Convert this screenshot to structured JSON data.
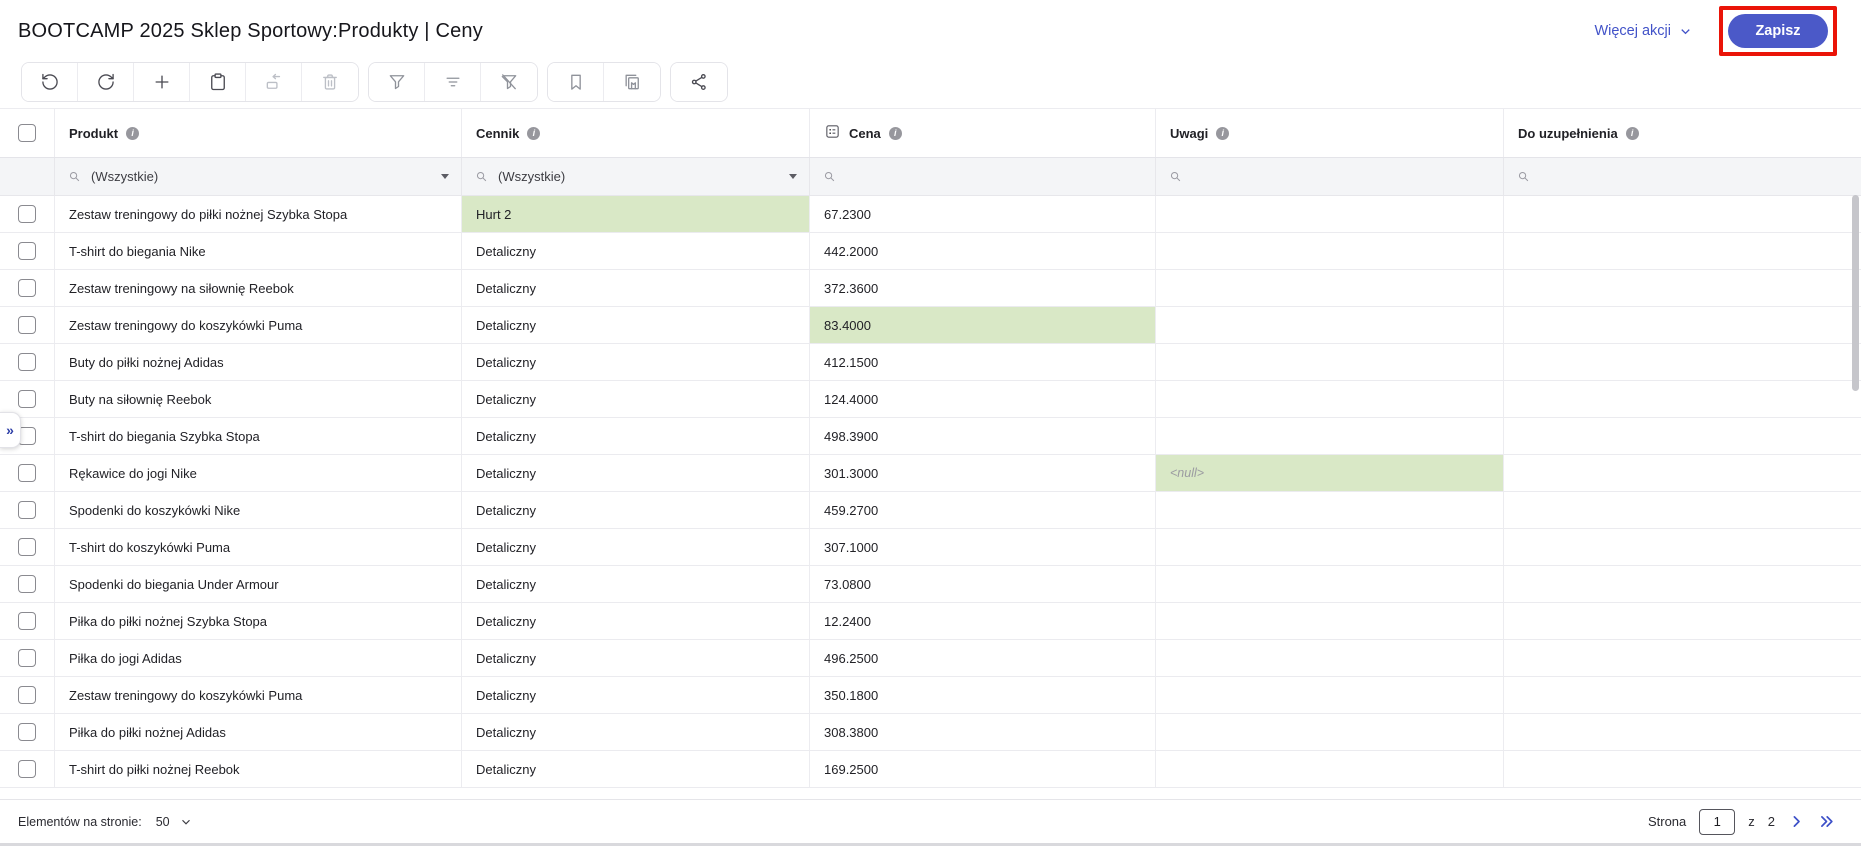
{
  "page": {
    "title": "BOOTCAMP 2025 Sklep Sportowy:Produkty | Ceny"
  },
  "header": {
    "more_actions": "Więcej akcji",
    "save": "Zapisz"
  },
  "colors": {
    "accent": "#4b59c8",
    "link": "#4152c8",
    "highlight_green": "#d9e8c6",
    "annotation_red": "#ea1408"
  },
  "toolbar": {
    "groups": [
      [
        "undo-icon",
        "redo-icon",
        "add-record-icon",
        "paste-icon",
        "insert-row-icon",
        "delete-icon"
      ],
      [
        "filter-icon",
        "filter-list-icon",
        "clear-filter-icon"
      ],
      [
        "bookmark-icon",
        "bookmarks-copy-icon"
      ],
      [
        "share-icon"
      ]
    ]
  },
  "table": {
    "columns": [
      {
        "label": "Produkt"
      },
      {
        "label": "Cennik"
      },
      {
        "label": "Cena"
      },
      {
        "label": "Uwagi"
      },
      {
        "label": "Do uzupełnienia"
      }
    ],
    "filter_all": "(Wszystkie)",
    "rows": [
      {
        "produkt": "Zestaw treningowy do piłki nożnej Szybka Stopa",
        "cennik": "Hurt 2",
        "cena": "67.2300",
        "uwagi": "",
        "uzup": "",
        "hl": "cennik"
      },
      {
        "produkt": "T-shirt do biegania Nike",
        "cennik": "Detaliczny",
        "cena": "442.2000",
        "uwagi": "",
        "uzup": "",
        "hl": null
      },
      {
        "produkt": "Zestaw treningowy na siłownię Reebok",
        "cennik": "Detaliczny",
        "cena": "372.3600",
        "uwagi": "",
        "uzup": "",
        "hl": null
      },
      {
        "produkt": "Zestaw treningowy do koszykówki Puma",
        "cennik": "Detaliczny",
        "cena": "83.4000",
        "uwagi": "",
        "uzup": "",
        "hl": "cena"
      },
      {
        "produkt": "Buty do piłki nożnej Adidas",
        "cennik": "Detaliczny",
        "cena": "412.1500",
        "uwagi": "",
        "uzup": "",
        "hl": null
      },
      {
        "produkt": "Buty na siłownię Reebok",
        "cennik": "Detaliczny",
        "cena": "124.4000",
        "uwagi": "",
        "uzup": "",
        "hl": null
      },
      {
        "produkt": "T-shirt do biegania Szybka Stopa",
        "cennik": "Detaliczny",
        "cena": "498.3900",
        "uwagi": "",
        "uzup": "",
        "hl": null
      },
      {
        "produkt": "Rękawice do jogi Nike",
        "cennik": "Detaliczny",
        "cena": "301.3000",
        "uwagi": "<null>",
        "uzup": "",
        "hl": "uwagi"
      },
      {
        "produkt": "Spodenki do koszykówki Nike",
        "cennik": "Detaliczny",
        "cena": "459.2700",
        "uwagi": "",
        "uzup": "",
        "hl": null
      },
      {
        "produkt": "T-shirt do koszykówki Puma",
        "cennik": "Detaliczny",
        "cena": "307.1000",
        "uwagi": "",
        "uzup": "",
        "hl": null
      },
      {
        "produkt": "Spodenki do biegania Under Armour",
        "cennik": "Detaliczny",
        "cena": "73.0800",
        "uwagi": "",
        "uzup": "",
        "hl": null
      },
      {
        "produkt": "Piłka do piłki nożnej Szybka Stopa",
        "cennik": "Detaliczny",
        "cena": "12.2400",
        "uwagi": "",
        "uzup": "",
        "hl": null
      },
      {
        "produkt": "Piłka do jogi Adidas",
        "cennik": "Detaliczny",
        "cena": "496.2500",
        "uwagi": "",
        "uzup": "",
        "hl": null
      },
      {
        "produkt": "Zestaw treningowy do koszykówki Puma",
        "cennik": "Detaliczny",
        "cena": "350.1800",
        "uwagi": "",
        "uzup": "",
        "hl": null
      },
      {
        "produkt": "Piłka do piłki nożnej Adidas",
        "cennik": "Detaliczny",
        "cena": "308.3800",
        "uwagi": "",
        "uzup": "",
        "hl": null
      },
      {
        "produkt": "T-shirt do piłki nożnej Reebok",
        "cennik": "Detaliczny",
        "cena": "169.2500",
        "uwagi": "",
        "uzup": "",
        "hl": null
      }
    ]
  },
  "footer": {
    "per_page_label": "Elementów na stronie:",
    "per_page": "50",
    "page_label": "Strona",
    "page": "1",
    "of_label": "z",
    "total_pages": "2"
  },
  "expander": "»"
}
